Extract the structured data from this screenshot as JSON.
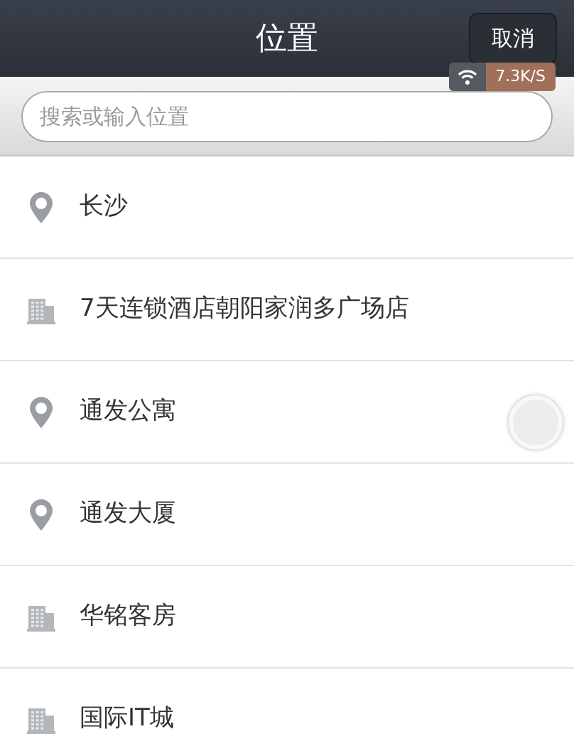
{
  "nav_bar": {
    "title": "位置",
    "cancel_button": "取消"
  },
  "network_badge": {
    "speed": "7.3K/S"
  },
  "search": {
    "placeholder": "搜索或输入位置"
  },
  "places": [
    {
      "kind": "pin",
      "name": "长沙"
    },
    {
      "kind": "building",
      "name": "7天连锁酒店朝阳家润多广场店"
    },
    {
      "kind": "pin",
      "name": "通发公寓"
    },
    {
      "kind": "pin",
      "name": "通发大厦"
    },
    {
      "kind": "building",
      "name": "华铭客房"
    },
    {
      "kind": "building",
      "name": "国际IT城"
    }
  ]
}
